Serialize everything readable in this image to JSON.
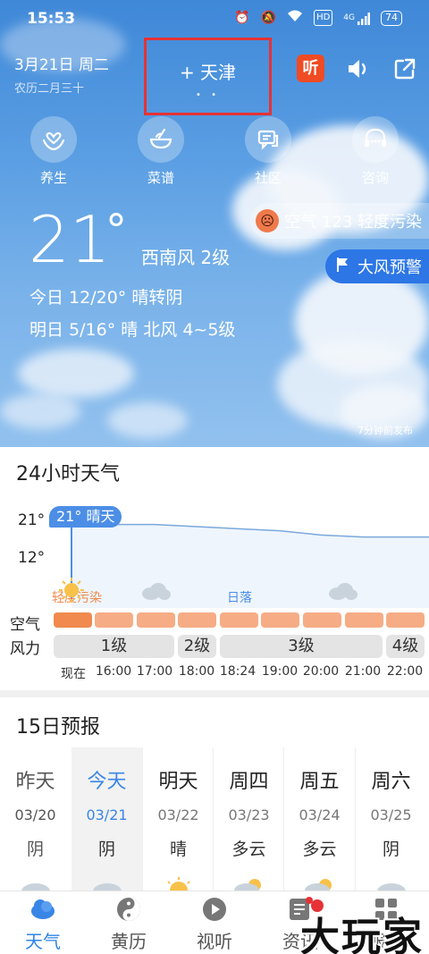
{
  "status_bar": {
    "time": "15:53",
    "network_label": "HD",
    "signal_label": "4G",
    "battery": "74"
  },
  "header": {
    "date": "3月21日 周二",
    "lunar": "农历二月三十",
    "city": "+ 天津",
    "city_dots": "• •",
    "listen_label": "听",
    "speaker_icon": "speaker-icon",
    "share_icon": "share-icon"
  },
  "quick_actions": [
    {
      "label": "养生",
      "icon": "heart-hands-icon"
    },
    {
      "label": "菜谱",
      "icon": "bowl-icon"
    },
    {
      "label": "社区",
      "icon": "chat-icon"
    },
    {
      "label": "咨询",
      "icon": "headset-icon"
    }
  ],
  "current": {
    "temperature": "21",
    "degree_symbol": "°",
    "wind": "西南风 2级",
    "today": "今日 12/20° 晴转阴",
    "tomorrow": "明日 5/16° 晴 北风 4~5级",
    "air_quality": "空气 123 轻度污染",
    "warning": "大风预警",
    "published": "7分钟前发布"
  },
  "hourly": {
    "title": "24小时天气",
    "tooltip": "21° 晴天",
    "y_high": "21°",
    "y_low": "12°",
    "air_label": "空气",
    "wind_label": "风力",
    "pollution_label": "轻度污染",
    "sunset_label": "日落",
    "times": [
      "现在",
      "16:00",
      "17:00",
      "18:00",
      "18:24",
      "19:00",
      "20:00",
      "21:00",
      "22:00"
    ],
    "wind_levels": [
      "1级",
      "2级",
      "3级",
      "4级"
    ],
    "air_color_now": "#f08a4e",
    "air_color": "#f6ad85"
  },
  "chart_data": {
    "type": "line",
    "title": "24小时天气",
    "x": [
      "现在",
      "16:00",
      "17:00",
      "18:00",
      "18:24",
      "19:00",
      "20:00",
      "21:00",
      "22:00"
    ],
    "series": [
      {
        "values": [
          21,
          20,
          20,
          19.5,
          19,
          18.5,
          17.5,
          17,
          17
        ]
      }
    ],
    "ylim": [
      12,
      21
    ],
    "grid": false
  },
  "forecast": {
    "title": "15日预报",
    "days": [
      {
        "name": "昨天",
        "date": "03/20",
        "cond": "阴",
        "icon": "cloud-icon"
      },
      {
        "name": "今天",
        "date": "03/21",
        "cond": "阴",
        "icon": "cloud-icon"
      },
      {
        "name": "明天",
        "date": "03/22",
        "cond": "晴",
        "icon": "sun-icon"
      },
      {
        "name": "周四",
        "date": "03/23",
        "cond": "多云",
        "icon": "partly-cloudy-icon"
      },
      {
        "name": "周五",
        "date": "03/24",
        "cond": "多云",
        "icon": "partly-cloudy-icon"
      },
      {
        "name": "周六",
        "date": "03/25",
        "cond": "阴",
        "icon": "cloud-icon"
      }
    ]
  },
  "nav": [
    {
      "label": "天气",
      "icon": "weather-icon",
      "active": true
    },
    {
      "label": "黄历",
      "icon": "yin-yang-icon",
      "active": false
    },
    {
      "label": "视听",
      "icon": "play-icon",
      "active": false
    },
    {
      "label": "资讯",
      "icon": "news-icon",
      "active": false
    },
    {
      "label": "服务",
      "icon": "grid-icon",
      "active": false
    }
  ],
  "watermark": "大玩家",
  "colors": {
    "accent": "#2f84e6",
    "highlight_box": "#e53236",
    "listen_bg": "#ef4b24"
  }
}
